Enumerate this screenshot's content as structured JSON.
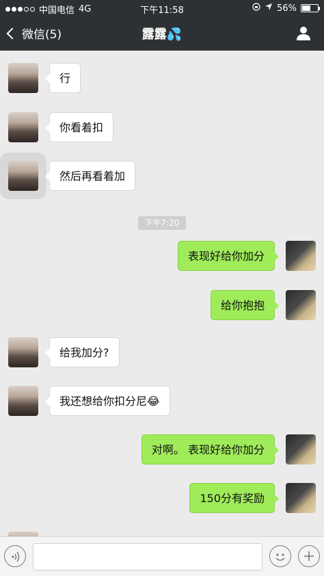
{
  "status_bar": {
    "carrier": "中国电信",
    "network": "4G",
    "time": "下午11:58",
    "battery": "56%",
    "battery_level": 0.56
  },
  "nav": {
    "back_label": "微信(5)",
    "title": "露露💦"
  },
  "timestamp": "下午7:20",
  "messages": [
    {
      "side": "in",
      "text": "行"
    },
    {
      "side": "in",
      "text": "你看着扣"
    },
    {
      "side": "in",
      "text": "然后再看着加"
    },
    {
      "side": "out",
      "text": "表现好给你加分"
    },
    {
      "side": "out",
      "text": "给你抱抱"
    },
    {
      "side": "in",
      "text": "给我加分?"
    },
    {
      "side": "in",
      "text": "我还想给你扣分尼😂"
    },
    {
      "side": "out",
      "text": "对啊。 表现好给你加分"
    },
    {
      "side": "out",
      "text": "150分有奖励"
    }
  ],
  "colors": {
    "nav_bg": "#2e3133",
    "chat_bg": "#ebebeb",
    "out_bubble": "#9feb5a",
    "in_bubble": "#ffffff"
  },
  "icons": {
    "back": "chevron-left-icon",
    "profile": "person-icon",
    "voice": "voice-icon",
    "emoji": "emoji-icon",
    "plus": "plus-icon"
  }
}
